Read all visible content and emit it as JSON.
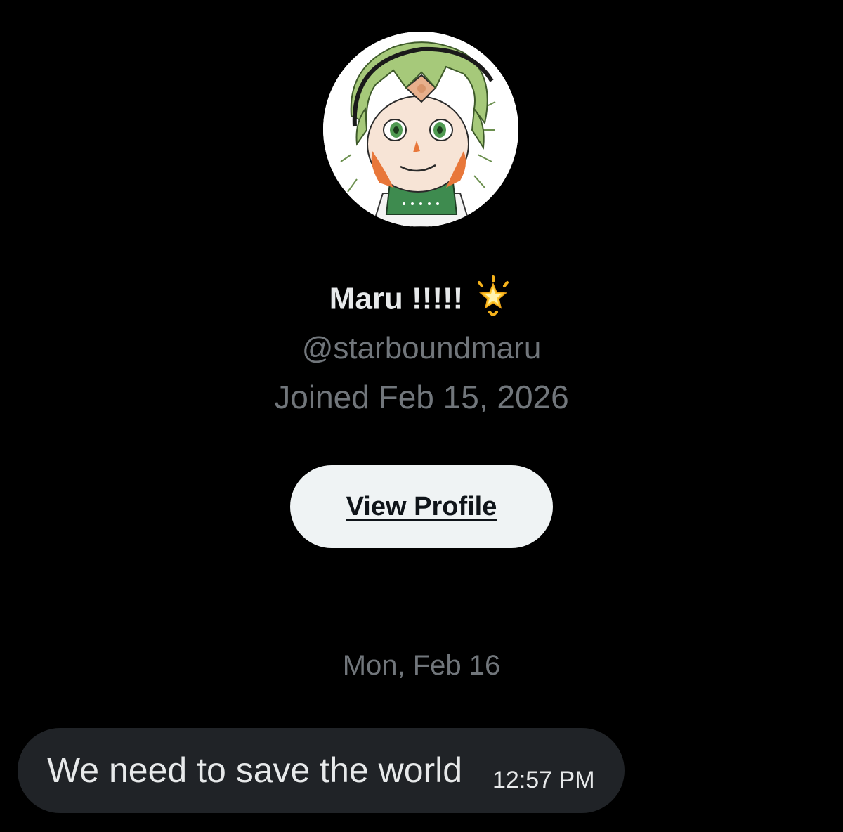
{
  "profile": {
    "display_name": "Maru !!!!!",
    "handle": "@starboundmaru",
    "joined": "Joined Feb 15, 2026",
    "view_profile_label": "View Profile"
  },
  "conversation": {
    "date_separator": "Mon, Feb 16",
    "messages": [
      {
        "text": "We need to save the world",
        "time": "12:57 PM"
      }
    ]
  },
  "colors": {
    "background": "#000000",
    "primary_text": "#e7e9ea",
    "secondary_text": "#71767b",
    "button_bg": "#eff3f4",
    "bubble_bg": "#202327"
  },
  "icons": {
    "name_emoji": "glowing-star-icon",
    "avatar": "avatar-anime-character"
  }
}
